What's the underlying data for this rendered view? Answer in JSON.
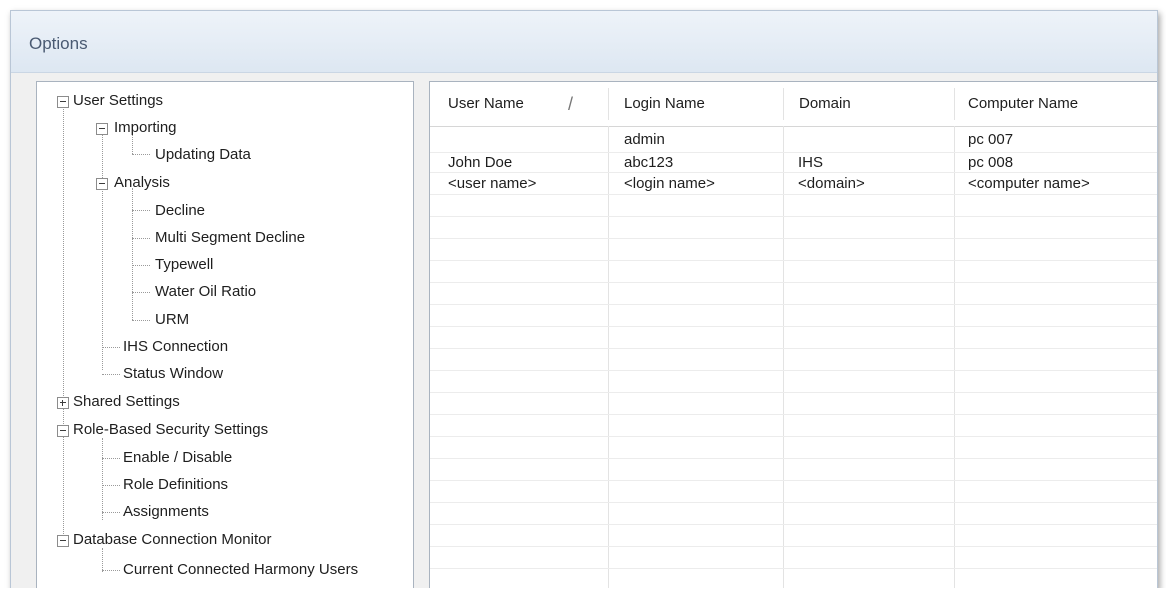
{
  "window": {
    "title": "Options"
  },
  "tree": {
    "items": [
      {
        "label": "User Settings"
      },
      {
        "label": "Importing"
      },
      {
        "label": "Updating Data"
      },
      {
        "label": "Analysis"
      },
      {
        "label": "Decline"
      },
      {
        "label": "Multi Segment Decline"
      },
      {
        "label": "Typewell"
      },
      {
        "label": "Water Oil Ratio"
      },
      {
        "label": "URM"
      },
      {
        "label": "IHS Connection"
      },
      {
        "label": "Status Window"
      },
      {
        "label": "Shared Settings"
      },
      {
        "label": "Role-Based Security Settings"
      },
      {
        "label": "Enable / Disable"
      },
      {
        "label": "Role Definitions"
      },
      {
        "label": "Assignments"
      },
      {
        "label": "Database Connection Monitor"
      },
      {
        "label": "Current Connected Harmony Users"
      }
    ]
  },
  "grid": {
    "columns": [
      "User Name",
      "Login Name",
      "Domain",
      "Computer Name"
    ],
    "rows": [
      [
        "",
        "admin",
        "",
        "pc 007"
      ],
      [
        "John Doe",
        "abc123",
        "IHS",
        "pc 008"
      ],
      [
        "<user name>",
        "<login name>",
        "<domain>",
        "<computer name>"
      ]
    ]
  }
}
